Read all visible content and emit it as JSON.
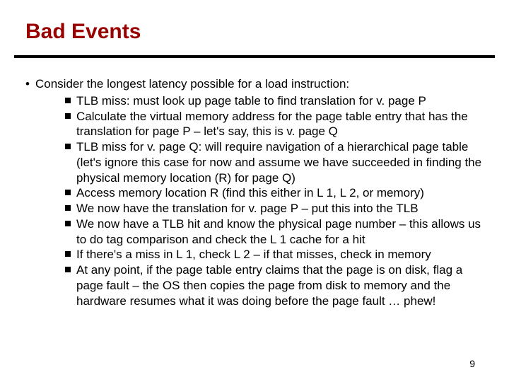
{
  "title": "Bad Events",
  "lead_bullet": "•",
  "lead_text": "Consider the longest latency possible for a load instruction:",
  "items": [
    "TLB miss: must look up page table to find translation for v. page P",
    "Calculate the virtual memory address for the page table entry that has the translation for page P – let's say, this is v. page Q",
    "TLB miss for v. page Q: will require navigation of a hierarchical page table (let's ignore this case for now and assume we have succeeded in finding the physical memory location (R) for page Q)",
    "Access memory location R (find this either in L 1, L 2, or memory)",
    "We now have the translation for v. page P – put this into the TLB",
    "We now have a TLB hit and know the physical page number – this allows us to do tag comparison and check the L 1 cache for a hit",
    "If there's a miss in L 1, check L 2 – if that misses, check in memory",
    "At any point, if the page table entry claims that the page is on disk, flag a page fault – the OS then copies the page from disk to memory and the hardware resumes what it was doing before the page fault … phew!"
  ],
  "page_number": "9"
}
